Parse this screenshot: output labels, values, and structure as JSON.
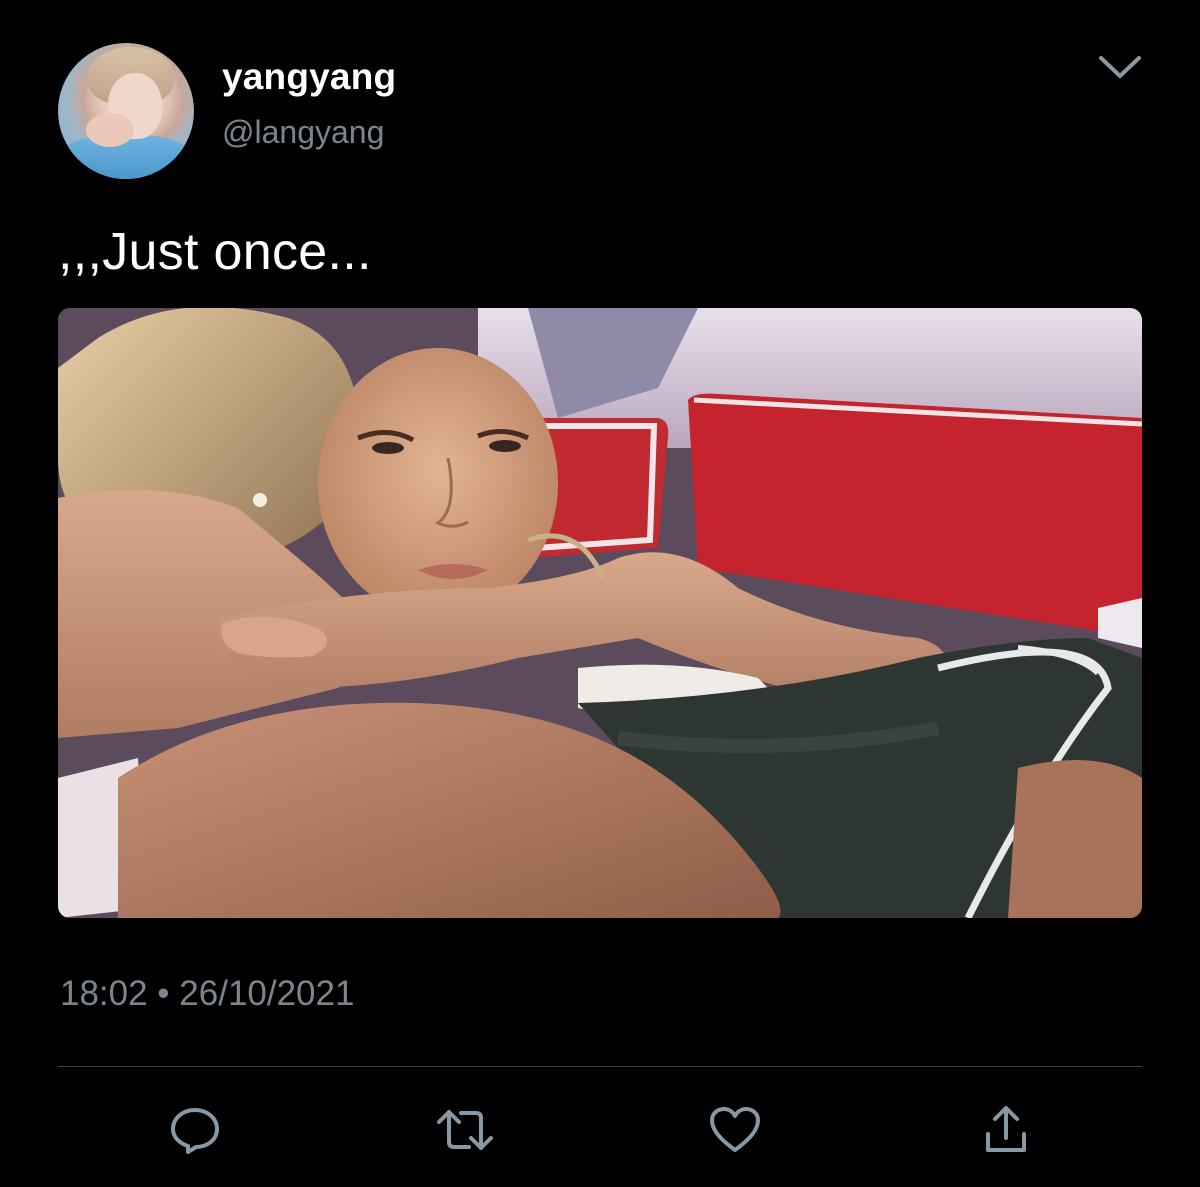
{
  "user": {
    "display_name": "yangyang",
    "handle": "@langyang"
  },
  "tweet": {
    "text": ",,,Just once...",
    "timestamp": "18:02 • 26/10/2021"
  },
  "icons": {
    "menu": "chevron-down-icon",
    "reply": "reply-icon",
    "retweet": "retweet-icon",
    "like": "heart-icon",
    "share": "share-icon"
  },
  "colors": {
    "background": "#000000",
    "text_primary": "#ffffff",
    "text_secondary": "#7c858e",
    "divider": "#38444d",
    "icon": "#8899a6"
  }
}
